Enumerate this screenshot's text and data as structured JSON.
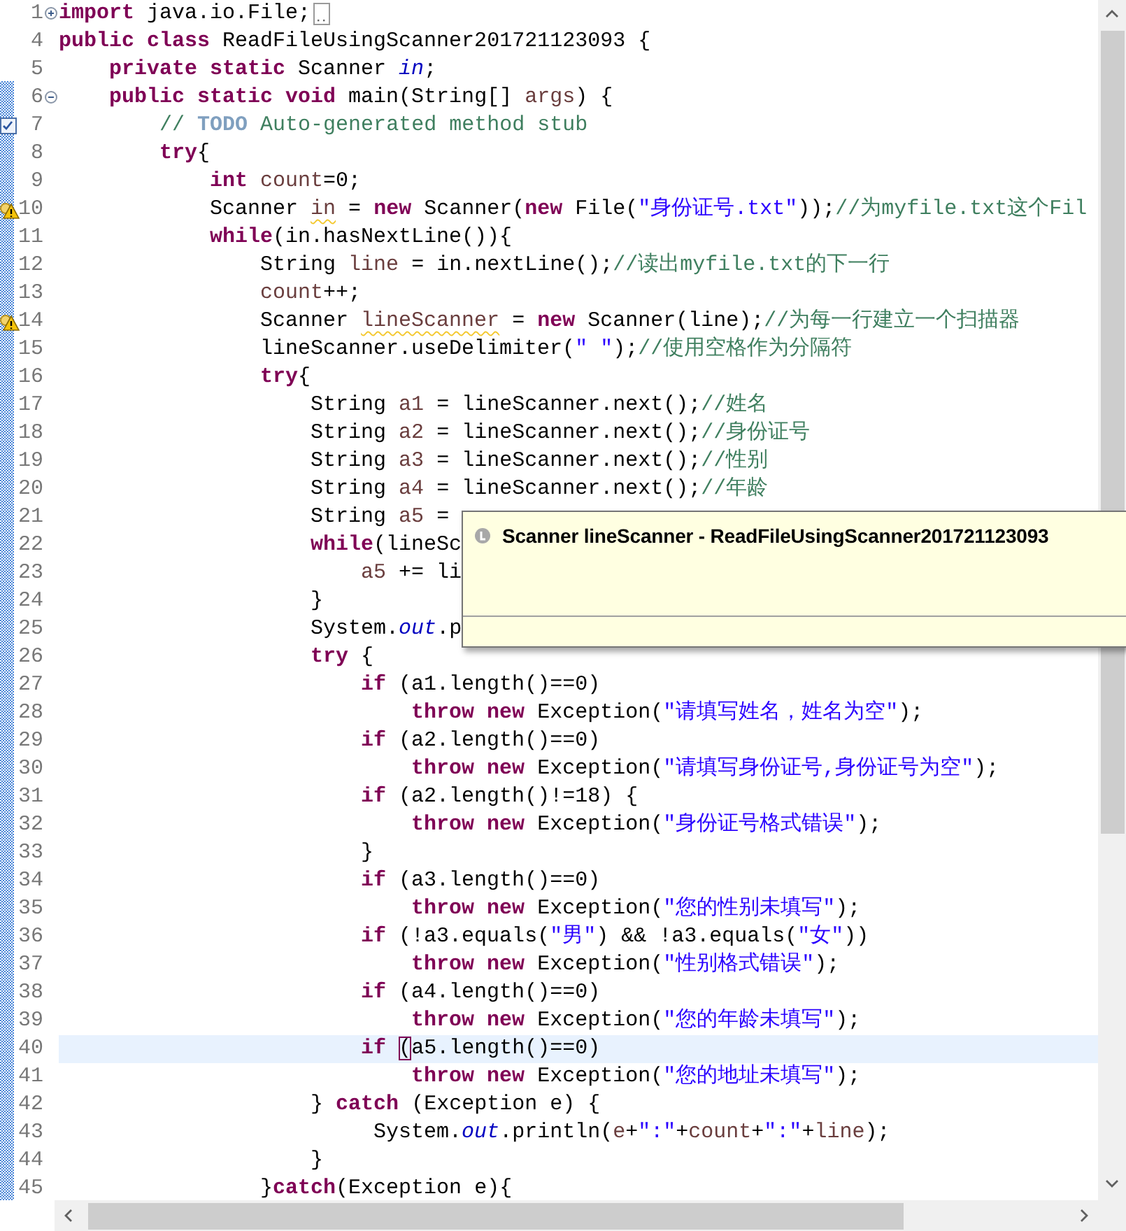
{
  "lines": [
    {
      "number": "1",
      "expanded": false,
      "folded_box": true,
      "current": false,
      "tokens": [
        {
          "kind": "k",
          "text": "import"
        },
        {
          "kind": "p",
          "text": " java.io.File;"
        }
      ]
    },
    {
      "number": "4",
      "current": false,
      "tokens": [
        {
          "kind": "k",
          "text": "public class"
        },
        {
          "kind": "p",
          "text": " ReadFileUsingScanner201721123093 {"
        }
      ]
    },
    {
      "number": "5",
      "current": false,
      "tokens": [
        {
          "kind": "k",
          "text": "    private static"
        },
        {
          "kind": "p",
          "text": " Scanner "
        },
        {
          "kind": "f",
          "text": "in"
        },
        {
          "kind": "p",
          "text": ";"
        }
      ]
    },
    {
      "number": "6",
      "expanded": true,
      "current": false,
      "tokens": [
        {
          "kind": "k",
          "text": "    public static void"
        },
        {
          "kind": "p",
          "text": " main(String[] "
        },
        {
          "kind": "v",
          "text": "args"
        },
        {
          "kind": "p",
          "text": ") {"
        }
      ]
    },
    {
      "number": "7",
      "task": true,
      "current": false,
      "tokens": [
        {
          "kind": "c",
          "text": "        // "
        },
        {
          "kind": "t",
          "text": "TODO"
        },
        {
          "kind": "c",
          "text": " Auto-generated method stub"
        }
      ]
    },
    {
      "number": "8",
      "current": false,
      "tokens": [
        {
          "kind": "k",
          "text": "        try"
        },
        {
          "kind": "p",
          "text": "{"
        }
      ]
    },
    {
      "number": "9",
      "current": false,
      "tokens": [
        {
          "kind": "k",
          "text": "            int"
        },
        {
          "kind": "v",
          "text": " count"
        },
        {
          "kind": "p",
          "text": "=0;"
        }
      ]
    },
    {
      "number": "10",
      "warning": true,
      "current": false,
      "tokens": [
        {
          "kind": "p",
          "text": "            Scanner "
        },
        {
          "kind": "w",
          "text": "in"
        },
        {
          "kind": "p",
          "text": " = "
        },
        {
          "kind": "k",
          "text": "new"
        },
        {
          "kind": "p",
          "text": " Scanner("
        },
        {
          "kind": "k",
          "text": "new"
        },
        {
          "kind": "p",
          "text": " File("
        },
        {
          "kind": "s",
          "text": "\"身份证号.txt\""
        },
        {
          "kind": "p",
          "text": "));"
        },
        {
          "kind": "c",
          "text": "//为myfile.txt这个Fil"
        }
      ]
    },
    {
      "number": "11",
      "current": false,
      "tokens": [
        {
          "kind": "k",
          "text": "            while"
        },
        {
          "kind": "p",
          "text": "(in.hasNextLine()){"
        }
      ]
    },
    {
      "number": "12",
      "current": false,
      "tokens": [
        {
          "kind": "p",
          "text": "                String "
        },
        {
          "kind": "v",
          "text": "line"
        },
        {
          "kind": "p",
          "text": " = in.nextLine();"
        },
        {
          "kind": "c",
          "text": "//读出myfile.txt的下一行"
        }
      ]
    },
    {
      "number": "13",
      "current": false,
      "tokens": [
        {
          "kind": "v",
          "text": "                count"
        },
        {
          "kind": "p",
          "text": "++;"
        }
      ]
    },
    {
      "number": "14",
      "warning": true,
      "current": false,
      "tokens": [
        {
          "kind": "p",
          "text": "                Scanner "
        },
        {
          "kind": "w",
          "text": "lineScanner"
        },
        {
          "kind": "p",
          "text": " = "
        },
        {
          "kind": "k",
          "text": "new"
        },
        {
          "kind": "p",
          "text": " Scanner(line);"
        },
        {
          "kind": "c",
          "text": "//为每一行建立一个扫描器"
        }
      ]
    },
    {
      "number": "15",
      "current": false,
      "tokens": [
        {
          "kind": "p",
          "text": "                lineScanner.useDelimiter("
        },
        {
          "kind": "s",
          "text": "\" \""
        },
        {
          "kind": "p",
          "text": ");"
        },
        {
          "kind": "c",
          "text": "//使用空格作为分隔符"
        }
      ]
    },
    {
      "number": "16",
      "current": false,
      "tokens": [
        {
          "kind": "k",
          "text": "                try"
        },
        {
          "kind": "p",
          "text": "{"
        }
      ]
    },
    {
      "number": "17",
      "current": false,
      "tokens": [
        {
          "kind": "p",
          "text": "                    String "
        },
        {
          "kind": "v",
          "text": "a1"
        },
        {
          "kind": "p",
          "text": " = lineScanner.next();"
        },
        {
          "kind": "c",
          "text": "//姓名"
        }
      ]
    },
    {
      "number": "18",
      "current": false,
      "tokens": [
        {
          "kind": "p",
          "text": "                    String "
        },
        {
          "kind": "v",
          "text": "a2"
        },
        {
          "kind": "p",
          "text": " = lineScanner.next();"
        },
        {
          "kind": "c",
          "text": "//身份证号"
        }
      ]
    },
    {
      "number": "19",
      "current": false,
      "tokens": [
        {
          "kind": "p",
          "text": "                    String "
        },
        {
          "kind": "v",
          "text": "a3"
        },
        {
          "kind": "p",
          "text": " = lineScanner.next();"
        },
        {
          "kind": "c",
          "text": "//性别"
        }
      ]
    },
    {
      "number": "20",
      "current": false,
      "tokens": [
        {
          "kind": "p",
          "text": "                    String "
        },
        {
          "kind": "v",
          "text": "a4"
        },
        {
          "kind": "p",
          "text": " = lineScanner.next();"
        },
        {
          "kind": "c",
          "text": "//年龄"
        }
      ]
    },
    {
      "number": "21",
      "current": false,
      "tokens": [
        {
          "kind": "p",
          "text": "                    String "
        },
        {
          "kind": "v",
          "text": "a5"
        },
        {
          "kind": "p",
          "text": " ="
        }
      ]
    },
    {
      "number": "22",
      "current": false,
      "tokens": [
        {
          "kind": "k",
          "text": "                    while"
        },
        {
          "kind": "p",
          "text": "(lineSc"
        }
      ]
    },
    {
      "number": "23",
      "current": false,
      "tokens": [
        {
          "kind": "v",
          "text": "                        a5"
        },
        {
          "kind": "p",
          "text": " += li"
        }
      ]
    },
    {
      "number": "24",
      "current": false,
      "tokens": [
        {
          "kind": "p",
          "text": "                    }"
        }
      ]
    },
    {
      "number": "25",
      "current": false,
      "tokens": [
        {
          "kind": "p",
          "text": "                    System."
        },
        {
          "kind": "f",
          "text": "out"
        },
        {
          "kind": "p",
          "text": ".p"
        }
      ]
    },
    {
      "number": "26",
      "current": false,
      "tokens": [
        {
          "kind": "k",
          "text": "                    try"
        },
        {
          "kind": "p",
          "text": " {"
        }
      ]
    },
    {
      "number": "27",
      "current": false,
      "tokens": [
        {
          "kind": "k",
          "text": "                        if"
        },
        {
          "kind": "p",
          "text": " (a1.length()==0)"
        }
      ]
    },
    {
      "number": "28",
      "current": false,
      "tokens": [
        {
          "kind": "k",
          "text": "                            throw new"
        },
        {
          "kind": "p",
          "text": " Exception("
        },
        {
          "kind": "s",
          "text": "\"请填写姓名，姓名为空\""
        },
        {
          "kind": "p",
          "text": ");"
        }
      ]
    },
    {
      "number": "29",
      "current": false,
      "tokens": [
        {
          "kind": "k",
          "text": "                        if"
        },
        {
          "kind": "p",
          "text": " (a2.length()==0)"
        }
      ]
    },
    {
      "number": "30",
      "current": false,
      "tokens": [
        {
          "kind": "k",
          "text": "                            throw new"
        },
        {
          "kind": "p",
          "text": " Exception("
        },
        {
          "kind": "s",
          "text": "\"请填写身份证号,身份证号为空\""
        },
        {
          "kind": "p",
          "text": ");"
        }
      ]
    },
    {
      "number": "31",
      "current": false,
      "tokens": [
        {
          "kind": "k",
          "text": "                        if"
        },
        {
          "kind": "p",
          "text": " (a2.length()!=18) {"
        }
      ]
    },
    {
      "number": "32",
      "current": false,
      "tokens": [
        {
          "kind": "k",
          "text": "                            throw new"
        },
        {
          "kind": "p",
          "text": " Exception("
        },
        {
          "kind": "s",
          "text": "\"身份证号格式错误\""
        },
        {
          "kind": "p",
          "text": ");"
        }
      ]
    },
    {
      "number": "33",
      "current": false,
      "tokens": [
        {
          "kind": "p",
          "text": "                        }"
        }
      ]
    },
    {
      "number": "34",
      "current": false,
      "tokens": [
        {
          "kind": "k",
          "text": "                        if"
        },
        {
          "kind": "p",
          "text": " (a3.length()==0)"
        }
      ]
    },
    {
      "number": "35",
      "current": false,
      "tokens": [
        {
          "kind": "k",
          "text": "                            throw new"
        },
        {
          "kind": "p",
          "text": " Exception("
        },
        {
          "kind": "s",
          "text": "\"您的性别未填写\""
        },
        {
          "kind": "p",
          "text": ");"
        }
      ]
    },
    {
      "number": "36",
      "current": false,
      "tokens": [
        {
          "kind": "k",
          "text": "                        if"
        },
        {
          "kind": "p",
          "text": " (!a3.equals("
        },
        {
          "kind": "s",
          "text": "\"男\""
        },
        {
          "kind": "p",
          "text": ") && !a3.equals("
        },
        {
          "kind": "s",
          "text": "\"女\""
        },
        {
          "kind": "p",
          "text": "))"
        }
      ]
    },
    {
      "number": "37",
      "current": false,
      "tokens": [
        {
          "kind": "k",
          "text": "                            throw new"
        },
        {
          "kind": "p",
          "text": " Exception("
        },
        {
          "kind": "s",
          "text": "\"性别格式错误\""
        },
        {
          "kind": "p",
          "text": ");"
        }
      ]
    },
    {
      "number": "38",
      "current": false,
      "tokens": [
        {
          "kind": "k",
          "text": "                        if"
        },
        {
          "kind": "p",
          "text": " (a4.length()==0)"
        }
      ]
    },
    {
      "number": "39",
      "current": false,
      "tokens": [
        {
          "kind": "k",
          "text": "                            throw new"
        },
        {
          "kind": "p",
          "text": " Exception("
        },
        {
          "kind": "s",
          "text": "\"您的年龄未填写\""
        },
        {
          "kind": "p",
          "text": ");"
        }
      ]
    },
    {
      "number": "40",
      "current": true,
      "tokens": [
        {
          "kind": "k",
          "text": "                        if "
        },
        {
          "kind": "m",
          "text": "("
        },
        {
          "kind": "p",
          "text": "a5.length()==0)"
        }
      ]
    },
    {
      "number": "41",
      "current": false,
      "tokens": [
        {
          "kind": "k",
          "text": "                            throw new"
        },
        {
          "kind": "p",
          "text": " Exception("
        },
        {
          "kind": "s",
          "text": "\"您的地址未填写\""
        },
        {
          "kind": "p",
          "text": ");"
        }
      ]
    },
    {
      "number": "42",
      "current": false,
      "tokens": [
        {
          "kind": "p",
          "text": "                    } "
        },
        {
          "kind": "k",
          "text": "catch"
        },
        {
          "kind": "p",
          "text": " (Exception e) {"
        }
      ]
    },
    {
      "number": "43",
      "current": false,
      "tokens": [
        {
          "kind": "p",
          "text": "                         System."
        },
        {
          "kind": "f",
          "text": "out"
        },
        {
          "kind": "p",
          "text": ".println("
        },
        {
          "kind": "v",
          "text": "e"
        },
        {
          "kind": "p",
          "text": "+"
        },
        {
          "kind": "s",
          "text": "\":\""
        },
        {
          "kind": "p",
          "text": "+"
        },
        {
          "kind": "v",
          "text": "count"
        },
        {
          "kind": "p",
          "text": "+"
        },
        {
          "kind": "s",
          "text": "\":\""
        },
        {
          "kind": "p",
          "text": "+"
        },
        {
          "kind": "v",
          "text": "line"
        },
        {
          "kind": "p",
          "text": ");"
        }
      ]
    },
    {
      "number": "44",
      "current": false,
      "tokens": [
        {
          "kind": "p",
          "text": "                    }"
        }
      ]
    },
    {
      "number": "45",
      "current": false,
      "tokens": [
        {
          "kind": "p",
          "text": "                }"
        },
        {
          "kind": "k",
          "text": "catch"
        },
        {
          "kind": "p",
          "text": "(Exception e){"
        }
      ]
    }
  ],
  "tooltip": {
    "title": "Scanner lineScanner - ReadFileUsingScanner201721123093"
  }
}
